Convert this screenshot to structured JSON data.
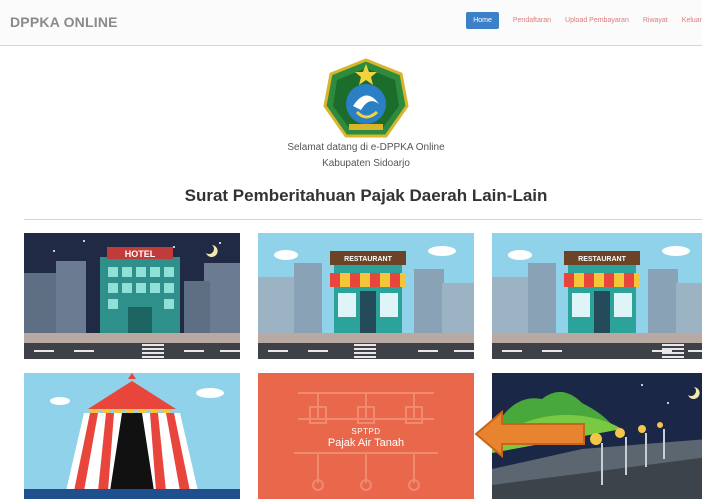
{
  "navbar": {
    "brand": "DPPKA ONLINE",
    "items": [
      {
        "label": "Home",
        "active": true
      },
      {
        "label": "Pendaftaran"
      },
      {
        "label": "Upload Pembayaran"
      },
      {
        "label": "Riwayat"
      },
      {
        "label": "Keluar"
      }
    ]
  },
  "header": {
    "welcome_line1": "Selamat datang di e-DPPKA Online",
    "welcome_line2": "Kabupaten Sidoarjo",
    "title": "Surat Pemberitahuan Pajak Daerah Lain-Lain"
  },
  "tiles": [
    {
      "icon": "hotel-icon",
      "sign": "HOTEL"
    },
    {
      "icon": "restaurant-icon",
      "sign": "RESTAURANT"
    },
    {
      "icon": "restaurant-icon",
      "sign": "RESTAURANT"
    },
    {
      "icon": "circus-tent-icon"
    },
    {
      "icon": "groundwater-icon",
      "caption": "SPTPD",
      "subtitle": "Pajak Air Tanah"
    },
    {
      "icon": "street-light-icon"
    }
  ],
  "colors": {
    "accent": "#3b80c9",
    "nav_link": "#e07a7a",
    "groundwater_tile": "#e9684b",
    "arrow": "#e8832f"
  }
}
